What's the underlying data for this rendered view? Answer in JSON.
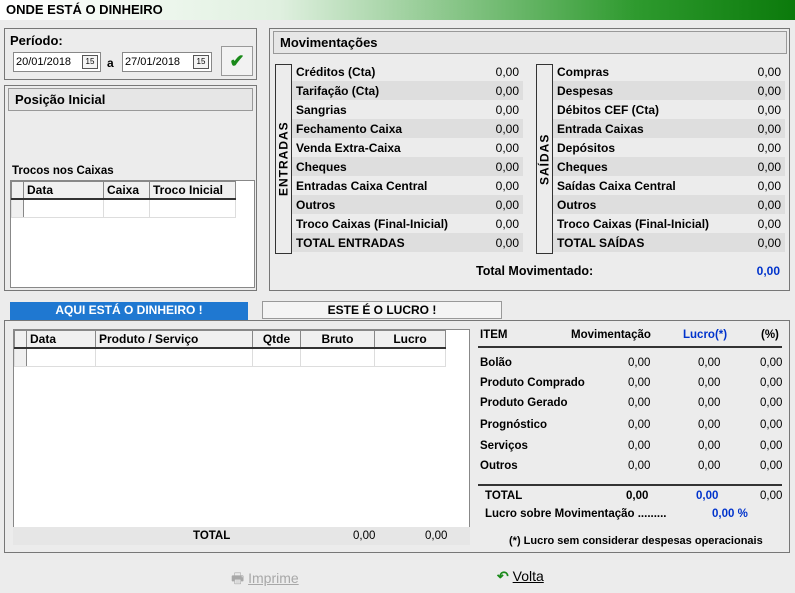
{
  "title": "ONDE ESTÁ O DINHEIRO",
  "periodo": {
    "label": "Período:",
    "start": "20/01/2018",
    "sep": "a",
    "end": "27/01/2018",
    "cal_icon": "15"
  },
  "posicao_inicial": {
    "title": "Posição Inicial",
    "trocos_label": "Trocos nos Caixas",
    "columns": [
      "Data",
      "Caixa",
      "Troco Inicial"
    ]
  },
  "movimentacoes": {
    "title": "Movimentações",
    "entradas_label": "ENTRADAS",
    "saidas_label": "SAÍDAS",
    "entradas": [
      {
        "label": "Créditos (Cta)",
        "value": "0,00"
      },
      {
        "label": "Tarifação (Cta)",
        "value": "0,00"
      },
      {
        "label": "Sangrias",
        "value": "0,00"
      },
      {
        "label": "Fechamento Caixa",
        "value": "0,00"
      },
      {
        "label": "Venda Extra-Caixa",
        "value": "0,00"
      },
      {
        "label": "Cheques",
        "value": "0,00"
      },
      {
        "label": "Entradas Caixa Central",
        "value": "0,00"
      },
      {
        "label": "Outros",
        "value": "0,00"
      },
      {
        "label": "Troco Caixas (Final-Inicial)",
        "value": "0,00"
      },
      {
        "label": "TOTAL ENTRADAS",
        "value": "0,00"
      }
    ],
    "saidas": [
      {
        "label": "Compras",
        "value": "0,00"
      },
      {
        "label": "Despesas",
        "value": "0,00"
      },
      {
        "label": "Débitos CEF (Cta)",
        "value": "0,00"
      },
      {
        "label": "Entrada Caixas",
        "value": "0,00"
      },
      {
        "label": "Depósitos",
        "value": "0,00"
      },
      {
        "label": "Cheques",
        "value": "0,00"
      },
      {
        "label": "Saídas Caixa Central",
        "value": "0,00"
      },
      {
        "label": "Outros",
        "value": "0,00"
      },
      {
        "label": "Troco Caixas (Final-Inicial)",
        "value": "0,00"
      },
      {
        "label": "TOTAL SAÍDAS",
        "value": "0,00"
      }
    ],
    "total_label": "Total Movimentado:",
    "total_value": "0,00"
  },
  "tabs": {
    "aqui": "AQUI ESTÁ O DINHEIRO !",
    "lucro": "ESTE É O LUCRO !"
  },
  "produtos": {
    "columns": [
      "Data",
      "Produto / Serviço",
      "Qtde",
      "Bruto",
      "Lucro"
    ],
    "total_label": "TOTAL",
    "total_bruto": "0,00",
    "total_lucro": "0,00"
  },
  "resumo": {
    "headers": {
      "item": "ITEM",
      "mov": "Movimentação",
      "lucro": "Lucro(*)",
      "pct": "(%)"
    },
    "rows": [
      {
        "item": "Bolão",
        "mov": "0,00",
        "lucro": "0,00",
        "pct": "0,00"
      },
      {
        "item": "Produto Comprado",
        "mov": "0,00",
        "lucro": "0,00",
        "pct": "0,00"
      },
      {
        "item": "Produto Gerado",
        "mov": "0,00",
        "lucro": "0,00",
        "pct": "0,00"
      },
      {
        "item": "Prognóstico",
        "mov": "0,00",
        "lucro": "0,00",
        "pct": "0,00"
      },
      {
        "item": "Serviços",
        "mov": "0,00",
        "lucro": "0,00",
        "pct": "0,00"
      },
      {
        "item": "Outros",
        "mov": "0,00",
        "lucro": "0,00",
        "pct": "0,00"
      }
    ],
    "total": {
      "item": "TOTAL",
      "mov": "0,00",
      "lucro": "0,00",
      "pct": "0,00"
    },
    "lucro_sobre_label": "Lucro sobre Movimentação .........",
    "lucro_sobre_value": "0,00 %",
    "footnote": "(*) Lucro sem considerar despesas operacionais"
  },
  "buttons": {
    "imprime": "Imprime",
    "volta": "Volta"
  },
  "icons": {
    "ok": "checkmark-icon",
    "print": "printer-icon",
    "back": "back-arrow-icon"
  },
  "colors": {
    "accent_blue": "#0033cc",
    "tab_blue": "#1f78d1",
    "title_green": "#0b7a0b"
  }
}
